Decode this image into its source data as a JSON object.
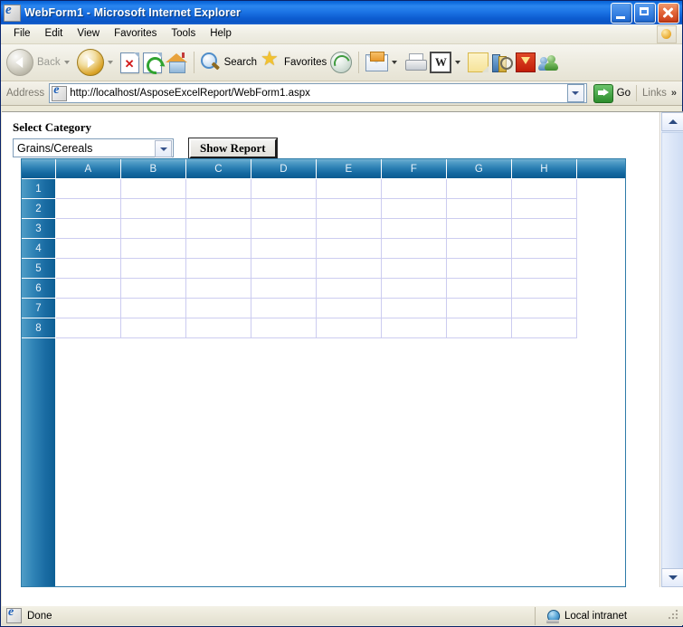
{
  "window": {
    "title": "WebForm1 - Microsoft Internet Explorer",
    "icon": "ie-document-icon",
    "buttons": {
      "minimize": "minimize-button",
      "maximize": "maximize-button",
      "close": "close-button"
    }
  },
  "menu": {
    "items": [
      {
        "label": "File"
      },
      {
        "label": "Edit"
      },
      {
        "label": "View"
      },
      {
        "label": "Favorites"
      },
      {
        "label": "Tools"
      },
      {
        "label": "Help"
      }
    ]
  },
  "toolbar": {
    "back_label": "Back",
    "search_label": "Search",
    "favorites_label": "Favorites",
    "icons": [
      "back-arrow-icon",
      "forward-arrow-icon",
      "stop-icon",
      "refresh-icon",
      "home-icon",
      "search-icon",
      "favorites-star-icon",
      "media-icon",
      "mail-icon",
      "print-icon",
      "edit-word-icon",
      "notes-icon",
      "research-icon",
      "download-manager-icon",
      "messenger-icon"
    ]
  },
  "address": {
    "label": "Address",
    "url": "http://localhost/AsposeExcelReport/WebForm1.aspx",
    "go_label": "Go",
    "links_label": "Links",
    "links_chevron": "»"
  },
  "page": {
    "select_label": "Select Category",
    "category": {
      "selected": "Grains/Cereals",
      "options": [
        "Grains/Cereals"
      ]
    },
    "show_report_label": "Show Report"
  },
  "grid": {
    "columns": [
      "A",
      "B",
      "C",
      "D",
      "E",
      "F",
      "G",
      "H"
    ],
    "rows": [
      "1",
      "2",
      "3",
      "4",
      "5",
      "6",
      "7",
      "8"
    ],
    "cells": [
      [
        "",
        "",
        "",
        "",
        "",
        "",
        "",
        ""
      ],
      [
        "",
        "",
        "",
        "",
        "",
        "",
        "",
        ""
      ],
      [
        "",
        "",
        "",
        "",
        "",
        "",
        "",
        ""
      ],
      [
        "",
        "",
        "",
        "",
        "",
        "",
        "",
        ""
      ],
      [
        "",
        "",
        "",
        "",
        "",
        "",
        "",
        ""
      ],
      [
        "",
        "",
        "",
        "",
        "",
        "",
        "",
        ""
      ],
      [
        "",
        "",
        "",
        "",
        "",
        "",
        "",
        ""
      ],
      [
        "",
        "",
        "",
        "",
        "",
        "",
        "",
        ""
      ]
    ]
  },
  "status": {
    "message": "Done",
    "zone": "Local intranet"
  },
  "colors": {
    "titlebar_blue": "#1b73e4",
    "grid_header_blue": "#2d81b4",
    "grid_gridline": "#ccccf0",
    "chrome_beige": "#ece9d8",
    "go_green": "#2c8c2c",
    "stop_red": "#d21a1a"
  }
}
